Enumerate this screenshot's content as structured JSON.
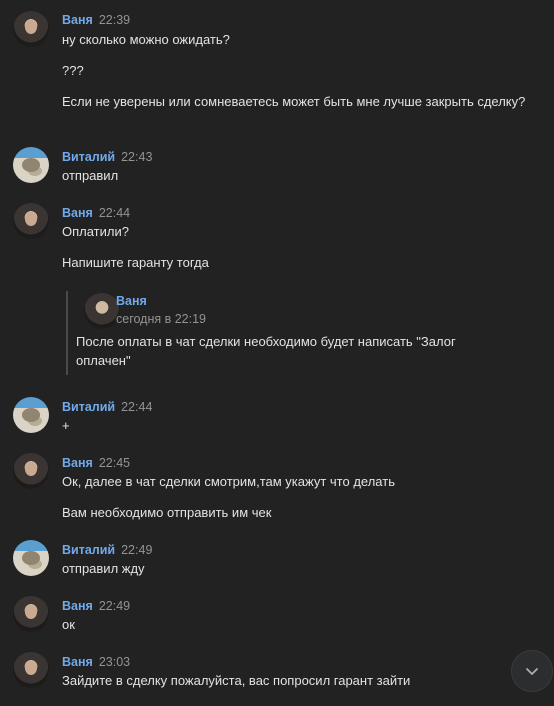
{
  "messages": [
    {
      "author": "Ваня",
      "time": "22:39",
      "avatar": "vanya",
      "lines": [
        "ну сколько можно ожидать?",
        "???",
        "Если не уверены или сомневаетесь может быть мне лучше закрыть сделку?"
      ]
    },
    {
      "author": "Виталий",
      "time": "22:43",
      "avatar": "vitaliy",
      "lines": [
        "отправил"
      ]
    },
    {
      "author": "Ваня",
      "time": "22:44",
      "avatar": "vanya",
      "lines": [
        "Оплатили?",
        "Напишите гаранту тогда"
      ],
      "reply": {
        "author": "Ваня",
        "time": "сегодня в 22:19",
        "text": "После оплаты в чат сделки необходимо будет написать \"Залог оплачен\""
      }
    },
    {
      "author": "Виталий",
      "time": "22:44",
      "avatar": "vitaliy",
      "lines": [
        "+"
      ]
    },
    {
      "author": "Ваня",
      "time": "22:45",
      "avatar": "vanya",
      "lines": [
        "Ок, далее в чат сделки смотрим,там укажут что делать",
        "Вам необходимо отправить им чек"
      ]
    },
    {
      "author": "Виталий",
      "time": "22:49",
      "avatar": "vitaliy",
      "lines": [
        "отправил жду"
      ]
    },
    {
      "author": "Ваня",
      "time": "22:49",
      "avatar": "vanya",
      "lines": [
        "ок"
      ]
    },
    {
      "author": "Ваня",
      "time": "23:03",
      "avatar": "vanya",
      "lines": [
        "Зайдите в сделку пожалуйста, вас попросил гарант зайти"
      ]
    }
  ],
  "colors": {
    "background": "#222222",
    "author": "#71aaeb",
    "time": "#939393",
    "text": "#e1e3e6"
  },
  "icons": {
    "scroll_down": "chevron-down-icon"
  }
}
